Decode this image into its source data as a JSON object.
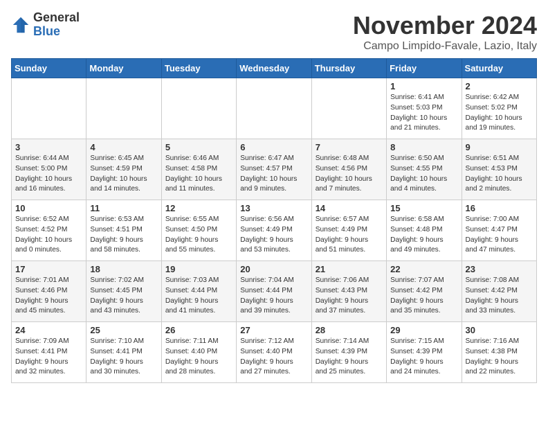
{
  "header": {
    "logo_general": "General",
    "logo_blue": "Blue",
    "month_title": "November 2024",
    "location": "Campo Limpido-Favale, Lazio, Italy"
  },
  "weekdays": [
    "Sunday",
    "Monday",
    "Tuesday",
    "Wednesday",
    "Thursday",
    "Friday",
    "Saturday"
  ],
  "weeks": [
    [
      {
        "day": "",
        "info": ""
      },
      {
        "day": "",
        "info": ""
      },
      {
        "day": "",
        "info": ""
      },
      {
        "day": "",
        "info": ""
      },
      {
        "day": "",
        "info": ""
      },
      {
        "day": "1",
        "info": "Sunrise: 6:41 AM\nSunset: 5:03 PM\nDaylight: 10 hours\nand 21 minutes."
      },
      {
        "day": "2",
        "info": "Sunrise: 6:42 AM\nSunset: 5:02 PM\nDaylight: 10 hours\nand 19 minutes."
      }
    ],
    [
      {
        "day": "3",
        "info": "Sunrise: 6:44 AM\nSunset: 5:00 PM\nDaylight: 10 hours\nand 16 minutes."
      },
      {
        "day": "4",
        "info": "Sunrise: 6:45 AM\nSunset: 4:59 PM\nDaylight: 10 hours\nand 14 minutes."
      },
      {
        "day": "5",
        "info": "Sunrise: 6:46 AM\nSunset: 4:58 PM\nDaylight: 10 hours\nand 11 minutes."
      },
      {
        "day": "6",
        "info": "Sunrise: 6:47 AM\nSunset: 4:57 PM\nDaylight: 10 hours\nand 9 minutes."
      },
      {
        "day": "7",
        "info": "Sunrise: 6:48 AM\nSunset: 4:56 PM\nDaylight: 10 hours\nand 7 minutes."
      },
      {
        "day": "8",
        "info": "Sunrise: 6:50 AM\nSunset: 4:55 PM\nDaylight: 10 hours\nand 4 minutes."
      },
      {
        "day": "9",
        "info": "Sunrise: 6:51 AM\nSunset: 4:53 PM\nDaylight: 10 hours\nand 2 minutes."
      }
    ],
    [
      {
        "day": "10",
        "info": "Sunrise: 6:52 AM\nSunset: 4:52 PM\nDaylight: 10 hours\nand 0 minutes."
      },
      {
        "day": "11",
        "info": "Sunrise: 6:53 AM\nSunset: 4:51 PM\nDaylight: 9 hours\nand 58 minutes."
      },
      {
        "day": "12",
        "info": "Sunrise: 6:55 AM\nSunset: 4:50 PM\nDaylight: 9 hours\nand 55 minutes."
      },
      {
        "day": "13",
        "info": "Sunrise: 6:56 AM\nSunset: 4:49 PM\nDaylight: 9 hours\nand 53 minutes."
      },
      {
        "day": "14",
        "info": "Sunrise: 6:57 AM\nSunset: 4:49 PM\nDaylight: 9 hours\nand 51 minutes."
      },
      {
        "day": "15",
        "info": "Sunrise: 6:58 AM\nSunset: 4:48 PM\nDaylight: 9 hours\nand 49 minutes."
      },
      {
        "day": "16",
        "info": "Sunrise: 7:00 AM\nSunset: 4:47 PM\nDaylight: 9 hours\nand 47 minutes."
      }
    ],
    [
      {
        "day": "17",
        "info": "Sunrise: 7:01 AM\nSunset: 4:46 PM\nDaylight: 9 hours\nand 45 minutes."
      },
      {
        "day": "18",
        "info": "Sunrise: 7:02 AM\nSunset: 4:45 PM\nDaylight: 9 hours\nand 43 minutes."
      },
      {
        "day": "19",
        "info": "Sunrise: 7:03 AM\nSunset: 4:44 PM\nDaylight: 9 hours\nand 41 minutes."
      },
      {
        "day": "20",
        "info": "Sunrise: 7:04 AM\nSunset: 4:44 PM\nDaylight: 9 hours\nand 39 minutes."
      },
      {
        "day": "21",
        "info": "Sunrise: 7:06 AM\nSunset: 4:43 PM\nDaylight: 9 hours\nand 37 minutes."
      },
      {
        "day": "22",
        "info": "Sunrise: 7:07 AM\nSunset: 4:42 PM\nDaylight: 9 hours\nand 35 minutes."
      },
      {
        "day": "23",
        "info": "Sunrise: 7:08 AM\nSunset: 4:42 PM\nDaylight: 9 hours\nand 33 minutes."
      }
    ],
    [
      {
        "day": "24",
        "info": "Sunrise: 7:09 AM\nSunset: 4:41 PM\nDaylight: 9 hours\nand 32 minutes."
      },
      {
        "day": "25",
        "info": "Sunrise: 7:10 AM\nSunset: 4:41 PM\nDaylight: 9 hours\nand 30 minutes."
      },
      {
        "day": "26",
        "info": "Sunrise: 7:11 AM\nSunset: 4:40 PM\nDaylight: 9 hours\nand 28 minutes."
      },
      {
        "day": "27",
        "info": "Sunrise: 7:12 AM\nSunset: 4:40 PM\nDaylight: 9 hours\nand 27 minutes."
      },
      {
        "day": "28",
        "info": "Sunrise: 7:14 AM\nSunset: 4:39 PM\nDaylight: 9 hours\nand 25 minutes."
      },
      {
        "day": "29",
        "info": "Sunrise: 7:15 AM\nSunset: 4:39 PM\nDaylight: 9 hours\nand 24 minutes."
      },
      {
        "day": "30",
        "info": "Sunrise: 7:16 AM\nSunset: 4:38 PM\nDaylight: 9 hours\nand 22 minutes."
      }
    ]
  ]
}
